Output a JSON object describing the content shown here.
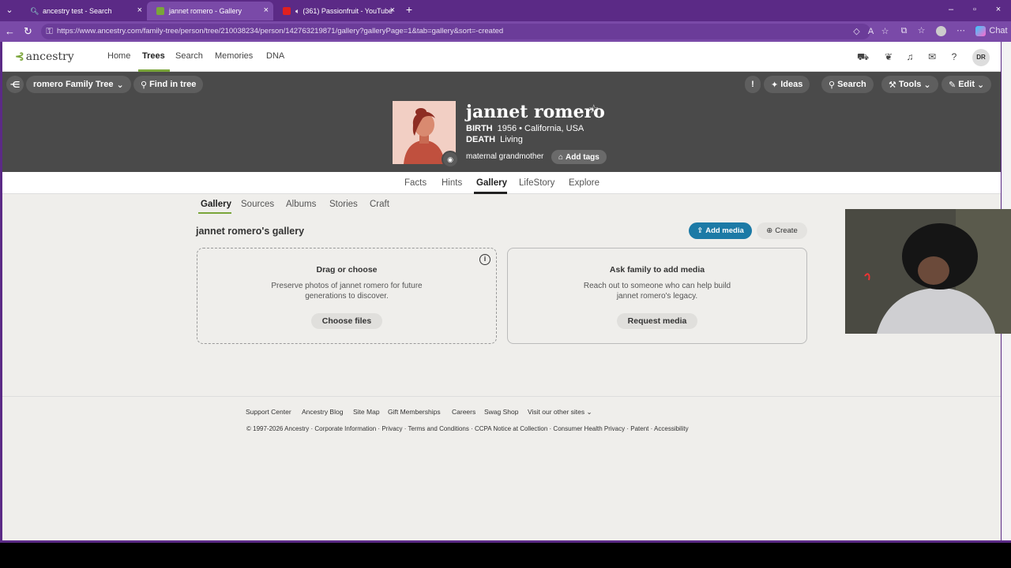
{
  "browser": {
    "tabs": [
      {
        "label": "ancestry test - Search",
        "active": false
      },
      {
        "label": "jannet romero - Gallery",
        "active": true
      },
      {
        "label": "(361) Passionfruit - YouTube",
        "active": false
      }
    ],
    "url": "https://www.ancestry.com/family-tree/person/tree/210038234/person/142763219871/gallery?galleryPage=1&tab=gallery&sort=-created",
    "chat_label": "Chat"
  },
  "site": {
    "logo": "ancestry",
    "nav": [
      "Home",
      "Trees",
      "Search",
      "Memories",
      "DNA"
    ],
    "active_nav": "Trees",
    "user_initials": "DR"
  },
  "toolbar": {
    "tree_name": "romero Family Tree",
    "find_in_tree": "Find in tree",
    "ideas": "Ideas",
    "search": "Search",
    "tools": "Tools",
    "edit": "Edit"
  },
  "person": {
    "name": "jannet romero",
    "birth_label": "BIRTH",
    "birth_value": "1956 • California, USA",
    "death_label": "DEATH",
    "death_value": "Living",
    "relationship": "maternal grandmother",
    "add_tags": "Add tags"
  },
  "person_tabs": [
    "Facts",
    "Hints",
    "Gallery",
    "LifeStory",
    "Explore"
  ],
  "sub_tabs": [
    "Gallery",
    "Sources",
    "Albums",
    "Stories",
    "Craft"
  ],
  "gallery": {
    "title": "jannet romero's gallery",
    "add_media": "Add media",
    "create": "Create",
    "drop_card": {
      "heading": "Drag or choose",
      "description": "Preserve photos of jannet romero for future generations to discover.",
      "button": "Choose files"
    },
    "ask_card": {
      "heading": "Ask family to add media",
      "description": "Reach out to someone who can help build jannet romero's legacy.",
      "button": "Request media"
    }
  },
  "footer": {
    "links": [
      "Support Center",
      "Ancestry Blog",
      "Site Map",
      "Gift Memberships",
      "Careers",
      "Swag Shop",
      "Visit our other sites"
    ],
    "copyright": "© 1997-2026 Ancestry · Corporate Information · Privacy · Terms and Conditions · CCPA Notice at Collection · Consumer Health Privacy · Patent · Accessibility"
  }
}
